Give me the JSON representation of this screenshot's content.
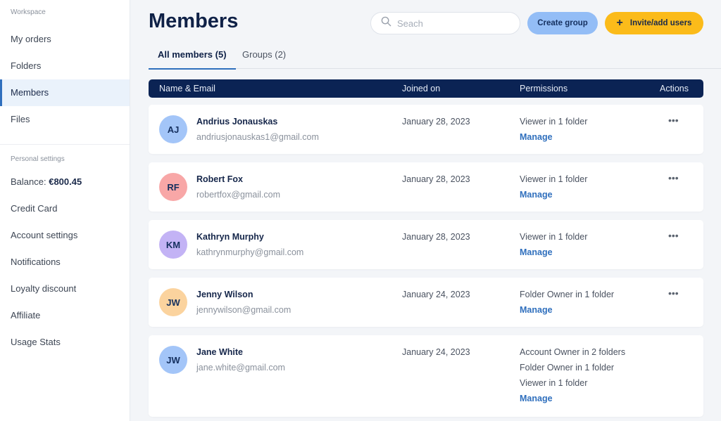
{
  "sidebar": {
    "workspace_label": "Workspace",
    "workspace_items": [
      {
        "label": "My orders",
        "active": false
      },
      {
        "label": "Folders",
        "active": false
      },
      {
        "label": "Members",
        "active": true
      },
      {
        "label": "Files",
        "active": false
      }
    ],
    "personal_label": "Personal settings",
    "balance_label": "Balance:",
    "balance_value": "€800.45",
    "personal_items": [
      {
        "label": "Credit Card"
      },
      {
        "label": "Account settings"
      },
      {
        "label": "Notifications"
      },
      {
        "label": "Loyalty discount"
      },
      {
        "label": "Affiliate"
      },
      {
        "label": "Usage Stats"
      }
    ]
  },
  "header": {
    "title": "Members",
    "search_placeholder": "Seach",
    "search_value": "",
    "create_group_label": "Create group",
    "invite_label": "Invite/add users",
    "invite_icon": "plus-icon"
  },
  "tabs": [
    {
      "label": "All members (5)",
      "active": true
    },
    {
      "label": "Groups (2)",
      "active": false
    }
  ],
  "table": {
    "columns": [
      "Name & Email",
      "Joined on",
      "Permissions",
      "Actions"
    ],
    "manage_label": "Manage",
    "more_label": "•••",
    "rows": [
      {
        "initials": "AJ",
        "avatar_color": "#a3c5f8",
        "name": "Andrius Jonauskas",
        "email": "andriusjonauskas1@gmail.com",
        "joined": "January 28, 2023",
        "permissions": [
          "Viewer in 1 folder"
        ],
        "has_actions": true
      },
      {
        "initials": "RF",
        "avatar_color": "#f8a7a7",
        "name": "Robert Fox",
        "email": "robertfox@gmail.com",
        "joined": "January 28, 2023",
        "permissions": [
          "Viewer in 1 folder"
        ],
        "has_actions": true
      },
      {
        "initials": "KM",
        "avatar_color": "#c3b3f5",
        "name": "Kathryn Murphy",
        "email": "kathrynmurphy@gmail.com",
        "joined": "January 28, 2023",
        "permissions": [
          "Viewer in 1 folder"
        ],
        "has_actions": true
      },
      {
        "initials": "JW",
        "avatar_color": "#fbd39e",
        "name": "Jenny Wilson",
        "email": "jennywilson@gmail.com",
        "joined": "January 24, 2023",
        "permissions": [
          "Folder Owner in 1 folder"
        ],
        "has_actions": true
      },
      {
        "initials": "JW",
        "avatar_color": "#a3c5f8",
        "name": "Jane White",
        "email": "jane.white@gmail.com",
        "joined": "January 24, 2023",
        "permissions": [
          "Account Owner in 2 folders",
          "Folder Owner in 1 folder",
          "Viewer in 1 folder"
        ],
        "has_actions": false
      }
    ]
  },
  "colors": {
    "accent": "#2f6fbd",
    "table_header": "#0b2354",
    "create_button": "#93bdf6",
    "invite_button": "#fbbb1a"
  }
}
